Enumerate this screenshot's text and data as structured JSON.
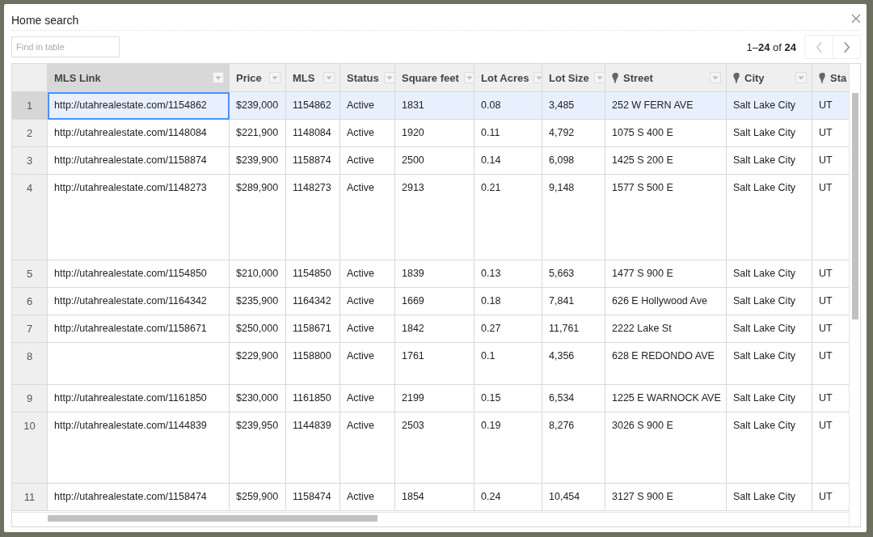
{
  "dialog": {
    "title": "Home search"
  },
  "search": {
    "placeholder": "Find in table"
  },
  "pager": {
    "range": "1–**24** of **24**",
    "prev_disabled": true,
    "next_disabled": false
  },
  "table": {
    "columns": [
      {
        "label": "MLS Link",
        "kind": "text",
        "selected": true
      },
      {
        "label": "Price",
        "kind": "text",
        "selected": false
      },
      {
        "label": "MLS",
        "kind": "text",
        "selected": false
      },
      {
        "label": "Status",
        "kind": "text",
        "selected": false
      },
      {
        "label": "Square feet",
        "kind": "text",
        "selected": false
      },
      {
        "label": "Lot Acres",
        "kind": "text",
        "selected": false
      },
      {
        "label": "Lot Size",
        "kind": "text",
        "selected": false
      },
      {
        "label": "Street",
        "kind": "location",
        "selected": false
      },
      {
        "label": "City",
        "kind": "location",
        "selected": false
      },
      {
        "label": "Sta",
        "kind": "location",
        "selected": false
      }
    ],
    "rows": [
      {
        "num": "1",
        "selected": true,
        "cells": [
          "http://utahrealestate.com/1154862",
          "$239,000",
          "1154862",
          "Active",
          "1831",
          "0.08",
          "3,485",
          "252 W FERN AVE",
          "Salt Lake City",
          "UT"
        ]
      },
      {
        "num": "2",
        "selected": false,
        "cells": [
          "http://utahrealestate.com/1148084",
          "$221,900",
          "1148084",
          "Active",
          "1920",
          "0.11",
          "4,792",
          "1075 S 400 E",
          "Salt Lake City",
          "UT"
        ]
      },
      {
        "num": "3",
        "selected": false,
        "cells": [
          "http://utahrealestate.com/1158874",
          "$239,900",
          "1158874",
          "Active",
          "2500",
          "0.14",
          "6,098",
          "1425 S 200 E",
          "Salt Lake City",
          "UT"
        ]
      },
      {
        "num": "4",
        "selected": false,
        "cells": [
          "http://utahrealestate.com/1148273",
          "$289,900",
          "1148273",
          "Active",
          "2913",
          "0.21",
          "9,148",
          "1577 S 500 E",
          "Salt Lake City",
          "UT"
        ]
      },
      {
        "num": "5",
        "selected": false,
        "cells": [
          "http://utahrealestate.com/1154850",
          "$210,000",
          "1154850",
          "Active",
          "1839",
          "0.13",
          "5,663",
          "1477 S 900 E",
          "Salt Lake City",
          "UT"
        ]
      },
      {
        "num": "6",
        "selected": false,
        "cells": [
          "http://utahrealestate.com/1164342",
          "$235,900",
          "1164342",
          "Active",
          "1669",
          "0.18",
          "7,841",
          "626 E Hollywood Ave",
          "Salt Lake City",
          "UT"
        ]
      },
      {
        "num": "7",
        "selected": false,
        "cells": [
          "http://utahrealestate.com/1158671",
          "$250,000",
          "1158671",
          "Active",
          "1842",
          "0.27",
          "11,761",
          "2222 Lake St",
          "Salt Lake City",
          "UT"
        ]
      },
      {
        "num": "8",
        "selected": false,
        "cells": [
          null,
          "$229,900",
          "1158800",
          "Active",
          "1761",
          "0.1",
          "4,356",
          "628 E REDONDO AVE",
          "Salt Lake City",
          "UT"
        ]
      },
      {
        "num": "9",
        "selected": false,
        "cells": [
          "http://utahrealestate.com/1161850",
          "$230,000",
          "1161850",
          "Active",
          "2199",
          "0.15",
          "6,534",
          "1225 E WARNOCK AVE",
          "Salt Lake City",
          "UT"
        ]
      },
      {
        "num": "10",
        "selected": false,
        "cells": [
          "http://utahrealestate.com/1144839",
          "$239,950",
          "1144839",
          "Active",
          "2503",
          "0.19",
          "8,276",
          "3026 S 900 E",
          "Salt Lake City",
          "UT"
        ]
      },
      {
        "num": "11",
        "selected": false,
        "cells": [
          "http://utahrealestate.com/1158474",
          "$259,900",
          "1158474",
          "Active",
          "1854",
          "0.24",
          "10,454",
          "3127 S 900 E",
          "Salt Lake City",
          "UT"
        ]
      }
    ]
  }
}
